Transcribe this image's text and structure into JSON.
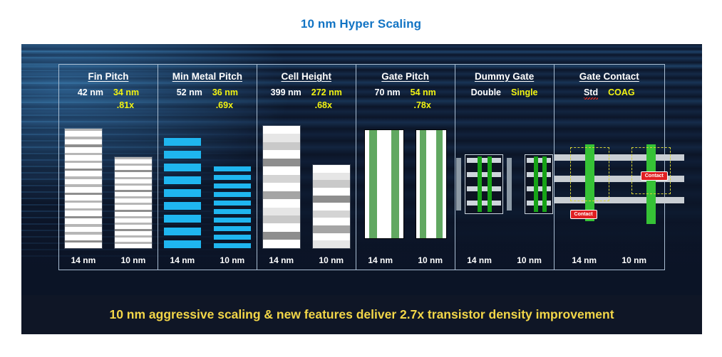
{
  "slide": {
    "title": "10 nm Hyper Scaling",
    "title_color": "#1274c4",
    "banner": "10 nm aggressive scaling & new features deliver 2.7x transistor density improvement",
    "banner_color": "#f2d648",
    "node_old": "14 nm",
    "node_new": "10 nm",
    "accent_old_color": "#ffffff",
    "accent_new_color": "#f2f312"
  },
  "columns": [
    {
      "title": "Fin Pitch",
      "old_value": "42 nm",
      "new_value": "34 nm",
      "ratio": ".81x",
      "node_old": "14 nm",
      "node_new": "10 nm"
    },
    {
      "title": "Min Metal Pitch",
      "old_value": "52 nm",
      "new_value": "36 nm",
      "ratio": ".69x",
      "node_old": "14 nm",
      "node_new": "10 nm"
    },
    {
      "title": "Cell Height",
      "old_value": "399 nm",
      "new_value": "272 nm",
      "ratio": ".68x",
      "node_old": "14 nm",
      "node_new": "10 nm"
    },
    {
      "title": "Gate Pitch",
      "old_value": "70 nm",
      "new_value": "54 nm",
      "ratio": ".78x",
      "node_old": "14 nm",
      "node_new": "10 nm"
    },
    {
      "title": "Dummy Gate",
      "old_value": "Double",
      "new_value": "Single",
      "ratio": "",
      "node_old": "14 nm",
      "node_new": "10 nm"
    },
    {
      "title": "Gate Contact",
      "old_value": "Std",
      "new_value": "COAG",
      "ratio": "",
      "node_old": "14 nm",
      "node_new": "10 nm",
      "contact_label": "Contact"
    }
  ],
  "chart_data": {
    "type": "bar",
    "title": "10 nm Hyper Scaling",
    "categories": [
      "Fin Pitch",
      "Min Metal Pitch",
      "Cell Height",
      "Gate Pitch",
      "Dummy Gate",
      "Gate Contact"
    ],
    "series": [
      {
        "name": "14 nm",
        "values": [
          42,
          52,
          399,
          70,
          "Double",
          "Std"
        ]
      },
      {
        "name": "10 nm",
        "values": [
          34,
          36,
          272,
          54,
          "Single",
          "COAG"
        ]
      }
    ],
    "ratios": [
      ".81x",
      ".69x",
      ".68x",
      ".78x",
      "",
      ""
    ],
    "units": [
      "nm",
      "nm",
      "nm",
      "nm",
      "",
      ""
    ],
    "summary": "2.7x transistor density improvement",
    "legend": [
      "14 nm",
      "10 nm"
    ],
    "xlabel": "",
    "ylabel": ""
  }
}
